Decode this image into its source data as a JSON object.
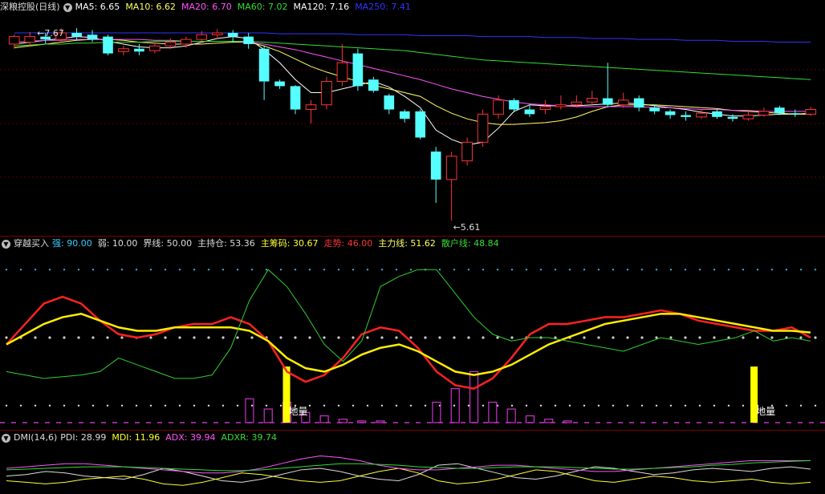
{
  "chart_data": [
    {
      "type": "candlestick",
      "title": "深粮控股(日线)",
      "indicators": [
        {
          "name": "MA5",
          "value": "6.65",
          "color": "#ffffff"
        },
        {
          "name": "MA10",
          "value": "6.62",
          "color": "#ffff66"
        },
        {
          "name": "MA20",
          "value": "6.70",
          "color": "#ff55ff"
        },
        {
          "name": "MA60",
          "value": "7.02",
          "color": "#33dd33"
        },
        {
          "name": "MA120",
          "value": "7.16",
          "color": "#ffffff"
        },
        {
          "name": "MA250",
          "value": "7.41",
          "color": "#3333ff"
        }
      ],
      "annotations": {
        "high": "7.67",
        "low": "5.61"
      },
      "ylim": [
        5.5,
        7.8
      ],
      "candles": [
        [
          7.5,
          7.58,
          7.6,
          7.45
        ],
        [
          7.52,
          7.58,
          7.63,
          7.48
        ],
        [
          7.58,
          7.55,
          7.62,
          7.5
        ],
        [
          7.55,
          7.62,
          7.67,
          7.52
        ],
        [
          7.62,
          7.58,
          7.67,
          7.54
        ],
        [
          7.6,
          7.55,
          7.65,
          7.52
        ],
        [
          7.58,
          7.4,
          7.6,
          7.38
        ],
        [
          7.42,
          7.45,
          7.48,
          7.38
        ],
        [
          7.45,
          7.42,
          7.5,
          7.38
        ],
        [
          7.43,
          7.48,
          7.52,
          7.4
        ],
        [
          7.48,
          7.52,
          7.56,
          7.45
        ],
        [
          7.5,
          7.55,
          7.58,
          7.46
        ],
        [
          7.55,
          7.6,
          7.64,
          7.52
        ],
        [
          7.6,
          7.62,
          7.66,
          7.55
        ],
        [
          7.62,
          7.58,
          7.65,
          7.52
        ],
        [
          7.58,
          7.5,
          7.62,
          7.45
        ],
        [
          7.45,
          7.1,
          7.48,
          6.9
        ],
        [
          7.1,
          7.05,
          7.12,
          7.02
        ],
        [
          7.05,
          6.8,
          7.06,
          6.75
        ],
        [
          6.8,
          6.85,
          6.9,
          6.65
        ],
        [
          6.85,
          7.1,
          7.15,
          6.8
        ],
        [
          7.1,
          7.3,
          7.5,
          7.05
        ],
        [
          7.4,
          7.05,
          7.45,
          7.0
        ],
        [
          7.12,
          7.0,
          7.15,
          6.98
        ],
        [
          6.95,
          6.8,
          6.97,
          6.75
        ],
        [
          6.78,
          6.7,
          6.8,
          6.66
        ],
        [
          6.78,
          6.5,
          6.8,
          6.48
        ],
        [
          6.35,
          6.05,
          6.4,
          5.8
        ],
        [
          6.05,
          6.3,
          6.35,
          5.61
        ],
        [
          6.25,
          6.45,
          6.5,
          6.2
        ],
        [
          6.45,
          6.75,
          6.8,
          6.4
        ],
        [
          6.75,
          6.9,
          6.95,
          6.7
        ],
        [
          6.9,
          6.8,
          6.92,
          6.78
        ],
        [
          6.8,
          6.75,
          6.85,
          6.72
        ],
        [
          6.8,
          6.83,
          6.9,
          6.75
        ],
        [
          6.83,
          6.85,
          6.95,
          6.8
        ],
        [
          6.85,
          6.88,
          6.95,
          6.82
        ],
        [
          6.88,
          6.92,
          7.0,
          6.85
        ],
        [
          6.92,
          6.85,
          7.3,
          6.82
        ],
        [
          6.85,
          6.9,
          6.98,
          6.82
        ],
        [
          6.92,
          6.82,
          6.95,
          6.78
        ],
        [
          6.82,
          6.78,
          6.85,
          6.75
        ],
        [
          6.78,
          6.74,
          6.8,
          6.7
        ],
        [
          6.74,
          6.72,
          6.78,
          6.68
        ],
        [
          6.72,
          6.76,
          6.8,
          6.7
        ],
        [
          6.78,
          6.72,
          6.8,
          6.7
        ],
        [
          6.72,
          6.7,
          6.75,
          6.67
        ],
        [
          6.7,
          6.74,
          6.78,
          6.68
        ],
        [
          6.74,
          6.78,
          6.82,
          6.72
        ],
        [
          6.82,
          6.76,
          6.84,
          6.74
        ],
        [
          6.76,
          6.75,
          6.8,
          6.72
        ],
        [
          6.75,
          6.8,
          6.83,
          6.73
        ]
      ],
      "ma_series": [
        {
          "name": "MA5",
          "color": "#ffffff",
          "values": [
            7.5,
            7.52,
            7.54,
            7.56,
            7.58,
            7.57,
            7.53,
            7.5,
            7.47,
            7.46,
            7.46,
            7.48,
            7.52,
            7.56,
            7.58,
            7.56,
            7.44,
            7.3,
            7.12,
            6.98,
            6.98,
            7.02,
            7.06,
            7.1,
            7.04,
            6.94,
            6.82,
            6.58,
            6.48,
            6.42,
            6.45,
            6.6,
            6.78,
            6.85,
            6.84,
            6.84,
            6.84,
            6.85,
            6.86,
            6.87,
            6.86,
            6.84,
            6.82,
            6.8,
            6.77,
            6.75,
            6.73,
            6.73,
            6.74,
            6.75,
            6.75,
            6.76
          ]
        },
        {
          "name": "MA10",
          "color": "#ffff66",
          "values": [
            7.46,
            7.48,
            7.5,
            7.52,
            7.54,
            7.55,
            7.55,
            7.54,
            7.52,
            7.51,
            7.5,
            7.5,
            7.5,
            7.51,
            7.52,
            7.52,
            7.48,
            7.42,
            7.34,
            7.26,
            7.2,
            7.15,
            7.1,
            7.06,
            7.02,
            6.98,
            6.94,
            6.84,
            6.76,
            6.7,
            6.66,
            6.64,
            6.64,
            6.65,
            6.66,
            6.68,
            6.72,
            6.78,
            6.83,
            6.85,
            6.85,
            6.85,
            6.84,
            6.83,
            6.82,
            6.81,
            6.79,
            6.78,
            6.77,
            6.76,
            6.75,
            6.75
          ]
        },
        {
          "name": "MA20",
          "color": "#ff55ff",
          "values": [
            7.52,
            7.53,
            7.54,
            7.54,
            7.55,
            7.55,
            7.55,
            7.55,
            7.55,
            7.54,
            7.54,
            7.53,
            7.53,
            7.53,
            7.53,
            7.52,
            7.5,
            7.47,
            7.44,
            7.4,
            7.36,
            7.32,
            7.28,
            7.24,
            7.2,
            7.16,
            7.12,
            7.07,
            7.02,
            6.98,
            6.94,
            6.91,
            6.88,
            6.86,
            6.85,
            6.84,
            6.83,
            6.83,
            6.83,
            6.83,
            6.83,
            6.82,
            6.82,
            6.81,
            6.8,
            6.8,
            6.79,
            6.79,
            6.78,
            6.78,
            6.78,
            6.78
          ]
        },
        {
          "name": "MA60",
          "color": "#33dd33",
          "values": [
            7.48,
            7.49,
            7.5,
            7.5,
            7.51,
            7.51,
            7.52,
            7.52,
            7.52,
            7.53,
            7.53,
            7.53,
            7.53,
            7.53,
            7.53,
            7.53,
            7.52,
            7.51,
            7.5,
            7.49,
            7.48,
            7.47,
            7.46,
            7.45,
            7.44,
            7.43,
            7.41,
            7.39,
            7.37,
            7.35,
            7.33,
            7.32,
            7.31,
            7.3,
            7.29,
            7.28,
            7.27,
            7.26,
            7.25,
            7.24,
            7.23,
            7.22,
            7.21,
            7.2,
            7.19,
            7.18,
            7.17,
            7.16,
            7.15,
            7.14,
            7.13,
            7.12
          ]
        },
        {
          "name": "MA250",
          "color": "#3333ff",
          "values": [
            7.62,
            7.62,
            7.62,
            7.62,
            7.62,
            7.62,
            7.62,
            7.62,
            7.62,
            7.62,
            7.62,
            7.62,
            7.62,
            7.62,
            7.62,
            7.62,
            7.62,
            7.61,
            7.61,
            7.61,
            7.61,
            7.61,
            7.6,
            7.6,
            7.6,
            7.6,
            7.59,
            7.59,
            7.59,
            7.59,
            7.58,
            7.58,
            7.58,
            7.58,
            7.57,
            7.57,
            7.57,
            7.56,
            7.56,
            7.56,
            7.55,
            7.55,
            7.55,
            7.54,
            7.54,
            7.54,
            7.53,
            7.53,
            7.53,
            7.52,
            7.52,
            7.52
          ]
        }
      ]
    },
    {
      "type": "line",
      "title": "穿越买入",
      "indicators": [
        {
          "name": "强",
          "value": "90.00",
          "color": "#33ccff"
        },
        {
          "name": "弱",
          "value": "10.00",
          "color": "#dddddd"
        },
        {
          "name": "界线",
          "value": "50.00",
          "color": "#dddddd"
        },
        {
          "name": "主持仓",
          "value": "53.36",
          "color": "#dddddd"
        },
        {
          "name": "主筹码",
          "value": "30.67",
          "color": "#ffff33"
        },
        {
          "name": "走势",
          "value": "46.00",
          "color": "#ff3333"
        },
        {
          "name": "主力线",
          "value": "51.62",
          "color": "#ffff66"
        },
        {
          "name": "散户线",
          "value": "48.84",
          "color": "#33dd33"
        }
      ],
      "volume_label": "地量",
      "ylim": [
        0,
        100
      ],
      "levels": [
        90,
        50,
        10
      ],
      "series": [
        {
          "name": "走势",
          "color": "#ff2222",
          "values": [
            46,
            58,
            70,
            74,
            70,
            60,
            52,
            50,
            52,
            56,
            58,
            58,
            62,
            58,
            48,
            30,
            24,
            28,
            38,
            52,
            56,
            54,
            44,
            30,
            22,
            20,
            26,
            38,
            52,
            58,
            58,
            60,
            62,
            62,
            64,
            66,
            64,
            60,
            58,
            56,
            54,
            54,
            56,
            50
          ]
        },
        {
          "name": "主力线",
          "color": "#ffee00",
          "values": [
            46,
            52,
            58,
            62,
            64,
            60,
            56,
            54,
            54,
            56,
            56,
            56,
            56,
            54,
            48,
            38,
            32,
            30,
            34,
            40,
            44,
            46,
            42,
            36,
            30,
            28,
            30,
            34,
            40,
            46,
            50,
            54,
            58,
            60,
            62,
            64,
            64,
            62,
            60,
            58,
            56,
            54,
            54,
            53
          ]
        },
        {
          "name": "散户线",
          "color": "#33cc33",
          "values": [
            30,
            28,
            26,
            27,
            28,
            30,
            38,
            34,
            30,
            26,
            26,
            28,
            44,
            72,
            90,
            80,
            64,
            46,
            36,
            48,
            80,
            86,
            90,
            90,
            76,
            62,
            52,
            48,
            50,
            50,
            48,
            46,
            44,
            42,
            46,
            50,
            48,
            46,
            48,
            50,
            54,
            48,
            50,
            48
          ]
        },
        {
          "name": "主筹码",
          "color": "#cc33cc",
          "type": "bar",
          "values": [
            0,
            0,
            0,
            0,
            0,
            0,
            0,
            0,
            0,
            0,
            0,
            0,
            0,
            14,
            8,
            12,
            6,
            4,
            2,
            1,
            1,
            0,
            0,
            12,
            20,
            30,
            12,
            8,
            4,
            2,
            1,
            0,
            0,
            0,
            0,
            0,
            0,
            0,
            0,
            0,
            0,
            0,
            0,
            0
          ]
        }
      ]
    },
    {
      "type": "line",
      "title": "DMI(14,6)",
      "indicators": [
        {
          "name": "PDI",
          "value": "28.99",
          "color": "#dddddd"
        },
        {
          "name": "MDI",
          "value": "11.96",
          "color": "#ffff33"
        },
        {
          "name": "ADX",
          "value": "39.94",
          "color": "#ff55ff"
        },
        {
          "name": "ADXR",
          "value": "39.74",
          "color": "#33dd33"
        }
      ],
      "ylim": [
        0,
        60
      ],
      "series": [
        {
          "name": "PDI",
          "color": "#dddddd",
          "values": [
            20,
            22,
            26,
            24,
            20,
            18,
            16,
            22,
            30,
            26,
            20,
            14,
            12,
            16,
            22,
            28,
            30,
            26,
            20,
            16,
            14,
            22,
            34,
            36,
            30,
            24,
            18,
            16,
            20,
            26,
            32,
            30,
            26,
            22,
            24,
            28,
            30,
            28,
            26,
            30,
            32,
            29
          ]
        },
        {
          "name": "MDI",
          "color": "#ffff33",
          "values": [
            14,
            12,
            10,
            12,
            16,
            18,
            20,
            16,
            10,
            8,
            12,
            18,
            24,
            22,
            18,
            14,
            12,
            14,
            20,
            26,
            30,
            24,
            14,
            10,
            12,
            16,
            22,
            28,
            26,
            20,
            14,
            12,
            16,
            20,
            18,
            14,
            12,
            14,
            16,
            12,
            10,
            12
          ]
        },
        {
          "name": "ADX",
          "color": "#ff55ff",
          "values": [
            30,
            32,
            34,
            36,
            36,
            34,
            32,
            30,
            28,
            26,
            24,
            24,
            26,
            30,
            36,
            42,
            46,
            44,
            40,
            34,
            30,
            28,
            28,
            30,
            32,
            34,
            34,
            32,
            30,
            28,
            26,
            26,
            28,
            30,
            32,
            34,
            36,
            38,
            40,
            40,
            40,
            40
          ]
        },
        {
          "name": "ADXR",
          "color": "#33dd33",
          "values": [
            28,
            29,
            30,
            31,
            32,
            32,
            32,
            31,
            30,
            29,
            28,
            27,
            27,
            28,
            30,
            32,
            34,
            36,
            36,
            35,
            34,
            32,
            31,
            30,
            30,
            31,
            32,
            32,
            32,
            31,
            30,
            29,
            29,
            30,
            31,
            32,
            34,
            35,
            37,
            38,
            39,
            40
          ]
        }
      ]
    }
  ]
}
